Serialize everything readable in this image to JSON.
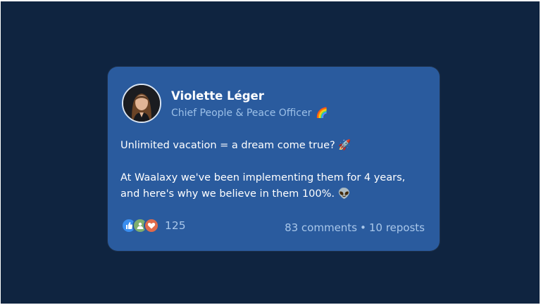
{
  "post": {
    "author": {
      "name": "Violette Léger",
      "role": "Chief People & Peace Officer",
      "role_emoji": "🌈",
      "avatar_icon": "avatar-photo"
    },
    "text": {
      "line1": "Unlimited vacation = a dream come true? 🚀",
      "line2": "At Waalaxy we've been implementing them for 4 years,",
      "line3": "and here's why we believe in them 100%. 👽"
    },
    "reactions": {
      "icons": [
        "like-icon",
        "support-icon",
        "love-icon"
      ],
      "count": "125"
    },
    "stats": {
      "comments": "83 comments",
      "separator": "•",
      "reposts": "10 reposts"
    }
  },
  "colors": {
    "background": "#0f2440",
    "card": "#2a5b9e",
    "secondary_text": "#a9c7ea",
    "like": "#3a8ef0",
    "support": "#7fae6e",
    "love": "#e06a4a"
  }
}
